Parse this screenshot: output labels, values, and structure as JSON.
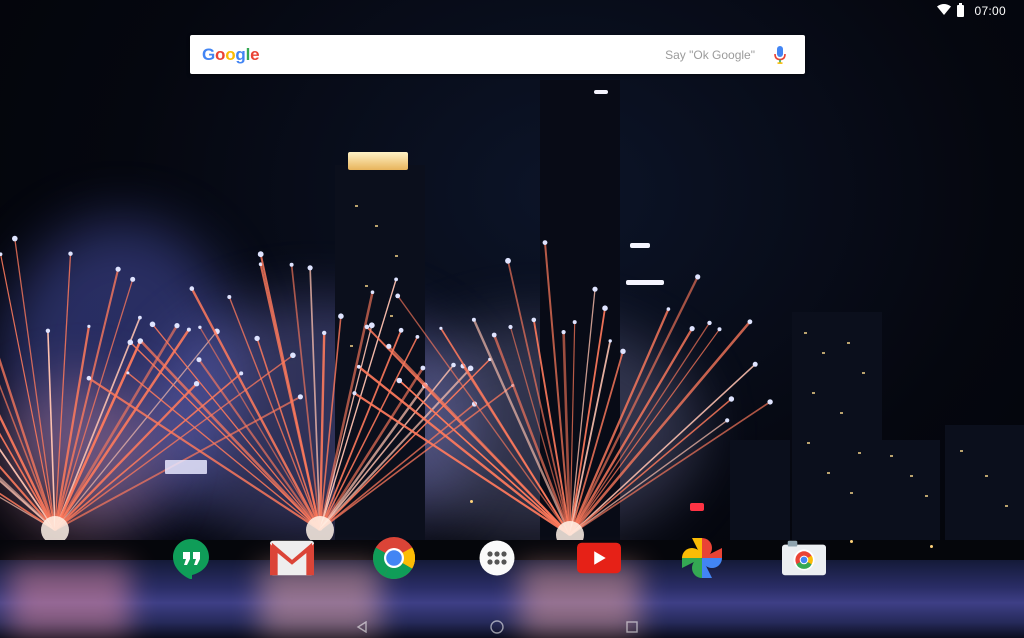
{
  "status_bar": {
    "icons": [
      "wifi-icon",
      "battery-icon"
    ],
    "time": "07:00"
  },
  "search": {
    "logo_letters": [
      {
        "char": "G",
        "color": "#4285F4"
      },
      {
        "char": "o",
        "color": "#EA4335"
      },
      {
        "char": "o",
        "color": "#FBBC05"
      },
      {
        "char": "g",
        "color": "#4285F4"
      },
      {
        "char": "l",
        "color": "#34A853"
      },
      {
        "char": "e",
        "color": "#EA4335"
      }
    ],
    "hint": "Say \"Ok Google\"",
    "mic_icon": "microphone-icon"
  },
  "dock": {
    "apps": [
      {
        "name": "hangouts",
        "icon": "hangouts-icon",
        "color": "#0F9D58"
      },
      {
        "name": "gmail",
        "icon": "gmail-icon",
        "color": "#DB4437"
      },
      {
        "name": "chrome",
        "icon": "chrome-icon",
        "color": "#4285F4"
      },
      {
        "name": "all-apps",
        "icon": "app-drawer-icon",
        "color": "#FFFFFF"
      },
      {
        "name": "youtube",
        "icon": "youtube-icon",
        "color": "#E62117"
      },
      {
        "name": "photos",
        "icon": "photos-pinwheel-icon",
        "color": "#FBBC05"
      },
      {
        "name": "camera",
        "icon": "camera-icon",
        "color": "#ECEFF1"
      }
    ]
  },
  "nav_bar": {
    "buttons": [
      "back-icon",
      "home-icon",
      "recents-icon"
    ]
  }
}
